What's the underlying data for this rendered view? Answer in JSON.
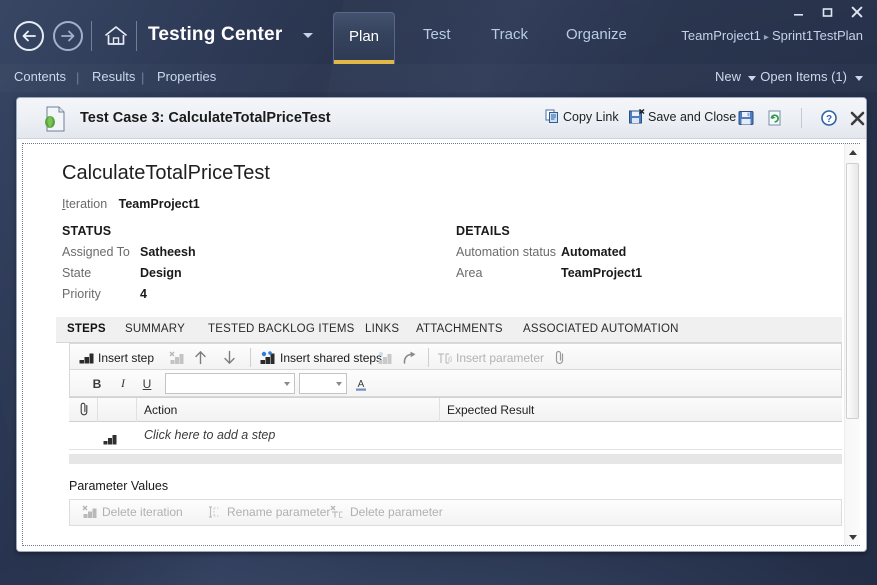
{
  "window": {
    "minimize_label": "–",
    "maximize_label": "❐",
    "close_label": "✕"
  },
  "topnav": {
    "back_icon": "arrow-left-circle-icon",
    "forward_icon": "arrow-right-circle-icon",
    "home_icon": "home-icon",
    "brand": "Testing Center",
    "brand_caret_icon": "chevron-down-icon",
    "tabs": [
      {
        "label": "Plan",
        "active": true
      },
      {
        "label": "Test",
        "active": false
      },
      {
        "label": "Track",
        "active": false
      },
      {
        "label": "Organize",
        "active": false
      }
    ],
    "breadcrumb": {
      "project": "TeamProject1",
      "separator": "▸",
      "plan": "Sprint1TestPlan"
    },
    "accent_underline_color": "#e0b94a"
  },
  "subnav": {
    "links": [
      {
        "label": "Contents"
      },
      {
        "label": "Results"
      },
      {
        "label": "Properties"
      }
    ],
    "pipe": "|",
    "new_label": "New",
    "open_items_label": "Open Items (1)"
  },
  "doc": {
    "file_icon": "test-case-document-icon",
    "title": "Test Case 3: CalculateTotalPriceTest",
    "actions": {
      "copy_link": "Copy Link",
      "copy_link_icon": "copy-link-icon",
      "save_and_close": "Save and Close",
      "save_and_close_icon": "save-close-icon",
      "save_icon": "save-icon",
      "refresh_icon": "refresh-icon",
      "help_icon": "help-icon",
      "close_icon": "close-icon"
    }
  },
  "testcase": {
    "name": "CalculateTotalPriceTest",
    "iteration_label": "Iteration",
    "iteration_value": "TeamProject1",
    "status": {
      "heading": "STATUS",
      "fields": [
        {
          "label": "Assigned To",
          "value": "Satheesh"
        },
        {
          "label": "State",
          "value": "Design"
        },
        {
          "label": "Priority",
          "value": "4"
        }
      ]
    },
    "details": {
      "heading": "DETAILS",
      "fields": [
        {
          "label": "Automation status",
          "value": "Automated"
        },
        {
          "label": "Area",
          "value": "TeamProject1"
        }
      ]
    },
    "tabs": [
      {
        "label": "STEPS",
        "active": true
      },
      {
        "label": "SUMMARY",
        "active": false
      },
      {
        "label": "TESTED BACKLOG ITEMS",
        "active": false
      },
      {
        "label": "LINKS",
        "active": false
      },
      {
        "label": "ATTACHMENTS",
        "active": false
      },
      {
        "label": "ASSOCIATED AUTOMATION",
        "active": false
      }
    ]
  },
  "steps_toolbar": {
    "insert_step": "Insert step",
    "insert_step_icon": "insert-step-icon",
    "insert_step_disabled_icon": "delete-step-icon",
    "move_up_icon": "arrow-up-icon",
    "move_down_icon": "arrow-down-icon",
    "insert_shared_steps": "Insert shared steps",
    "insert_shared_steps_icon": "shared-steps-icon",
    "shared_steps_disabled_icon": "open-shared-steps-icon",
    "redo_icon": "redo-arrow-icon",
    "insert_parameter": "Insert parameter",
    "insert_parameter_icon": "insert-parameter-icon",
    "attachment_icon": "paperclip-icon"
  },
  "format_toolbar": {
    "bold": "B",
    "italic": "I",
    "underline": "U",
    "font_family_value": "",
    "font_size_value": "",
    "font_color_icon": "font-color-icon",
    "font_color_glyph": "A",
    "caret_icon": "chevron-down-icon"
  },
  "grid": {
    "attachment_column_icon": "paperclip-icon",
    "columns": [
      "",
      "",
      "Action",
      "Expected Result"
    ],
    "add_step_icon": "insert-step-icon",
    "add_step_placeholder": "Click here to add a step",
    "rows": []
  },
  "parameters": {
    "title": "Parameter Values",
    "buttons": [
      {
        "label": "Delete iteration",
        "icon": "delete-iteration-icon",
        "disabled": true
      },
      {
        "label": "Rename parameter",
        "icon": "rename-parameter-icon",
        "disabled": true
      },
      {
        "label": "Delete parameter",
        "icon": "delete-parameter-icon",
        "disabled": true
      }
    ]
  },
  "scrollbar": {
    "up_icon": "scroll-up-arrow-icon",
    "down_icon": "scroll-down-arrow-icon",
    "thumb": "scroll-thumb"
  }
}
